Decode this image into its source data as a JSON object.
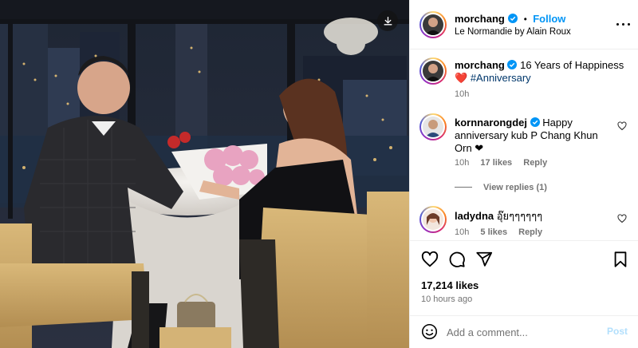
{
  "post": {
    "username": "morchang",
    "follow_label": "Follow",
    "dot": "•",
    "location": "Le Normandie by Alain Roux"
  },
  "caption": {
    "username": "morchang",
    "text_line1": "16 Years of Happiness",
    "heart": "❤️",
    "hashtag": "#Anniversary",
    "time": "10h"
  },
  "comments": [
    {
      "username": "kornnarongdej",
      "text_line1": "Happy",
      "text_line2": "anniversary kub P Chang Khun",
      "text_line3": "Orn ❤",
      "time": "10h",
      "likes": "17 likes",
      "reply": "Reply",
      "view_replies": "View replies (1)"
    },
    {
      "username": "ladydna",
      "text": "อุ๊ยๆๆๆๆๆๆ",
      "time": "10h",
      "likes": "5 likes",
      "reply": "Reply"
    }
  ],
  "stats": {
    "likes": "17,214 likes",
    "time_ago": "10 hours ago"
  },
  "comment_box": {
    "placeholder": "Add a comment...",
    "post_label": "Post"
  },
  "colors": {
    "link_blue": "#0095f6",
    "hashtag": "#00376b",
    "muted": "#737373",
    "post_disabled": "#b2dffc"
  },
  "icons": [
    "download-icon",
    "verified-badge-icon",
    "more-options-icon",
    "heart-icon",
    "comment-icon",
    "share-icon",
    "bookmark-icon",
    "emoji-icon"
  ]
}
